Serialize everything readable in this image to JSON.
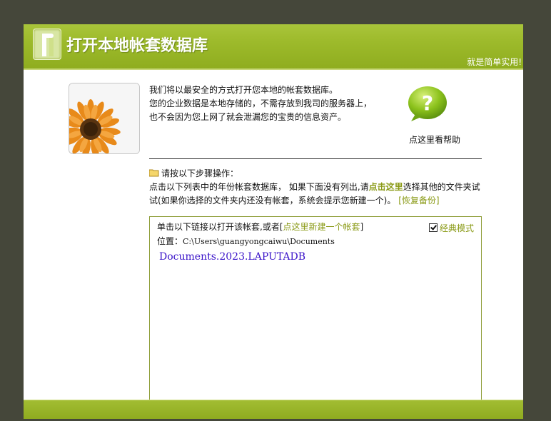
{
  "header": {
    "title": "打开本地帐套数据库",
    "tagline": "就是简单实用!"
  },
  "intro": {
    "lines": [
      "我们将以最安全的方式打开您本地的帐套数据库。",
      "您的企业数据是本地存储的，不需存放到我司的服务器上，",
      "也不会因为您上网了就会泄漏您的宝贵的信息资产。"
    ]
  },
  "help": {
    "label": "点这里看帮助"
  },
  "steps": {
    "heading": "请按以下步骤操作：",
    "text_part1": "点击以下列表中的年份帐套数据库，   如果下面没有列出,请",
    "click_here": "点击这里",
    "text_part2": "选择其他的文件夹试试(如果你选择的文件夹内还没有帐套，系统会提示您新建一个)。",
    "restore_link": "[恢复备份]"
  },
  "panel": {
    "instruction_prefix": "单击以下链接以打开该帐套,或者[",
    "new_account_link": "点这里新建一个帐套",
    "instruction_suffix": "]",
    "classic_mode_label": "经典模式",
    "classic_mode_checked": true,
    "location_label": "位置：",
    "location_path": "C:\\Users\\guangyongcaiwu\\Documents",
    "databases": [
      "Documents.2023.LAPUTADB"
    ]
  },
  "colors": {
    "accent": "#9dba2b",
    "link": "#8a9a16",
    "db_link": "#3a13c9"
  }
}
